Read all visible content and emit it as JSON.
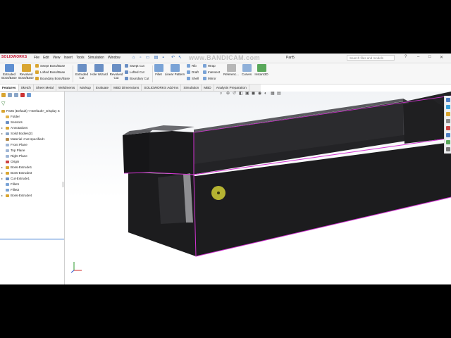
{
  "app": {
    "logo": "SOLIDWORKS",
    "document_title": "Part5",
    "watermark": "www.BANDICAM.com"
  },
  "menu": [
    "File",
    "Edit",
    "View",
    "Insert",
    "Tools",
    "Simulation",
    "Window"
  ],
  "search": {
    "placeholder": "Search files and models"
  },
  "window_controls": [
    "–",
    "□",
    "✕"
  ],
  "commands": {
    "extruded_boss": "Extruded Boss/Base",
    "revolved_boss": "Revolved Boss/Base",
    "swept_boss": "Swept Boss/Base",
    "lofted_boss": "Lofted Boss/Base",
    "boundary_boss": "Boundary Boss/Base",
    "extruded_cut": "Extruded Cut",
    "hole_wizard": "Hole Wizard",
    "revolved_cut": "Revolved Cut",
    "swept_cut": "Swept Cut",
    "lofted_cut": "Lofted Cut",
    "boundary_cut": "Boundary Cut",
    "fillet": "Fillet",
    "linear_pattern": "Linear Pattern",
    "rib": "Rib",
    "wrap": "Wrap",
    "draft": "Draft",
    "intersect": "Intersect",
    "shell": "Shell",
    "mirror": "Mirror",
    "reference_geometry": "Referenc...",
    "curves": "Curves",
    "instant3d": "Instant3D"
  },
  "tabs": [
    "Features",
    "Sketch",
    "Sheet Metal",
    "Weldments",
    "Markup",
    "Evaluate",
    "MBD Dimensions",
    "SOLIDWORKS Add-Ins",
    "Simulation",
    "MBD",
    "Analysis Preparation"
  ],
  "active_tab": "Features",
  "tree": {
    "root": "Part5 (Default) <<Default>_Display S",
    "items": [
      {
        "label": "Folder",
        "icon": "folder-icon",
        "expandable": false
      },
      {
        "label": "Sensors",
        "icon": "sensor-icon",
        "expandable": false
      },
      {
        "label": "Annotations",
        "icon": "annotation-icon",
        "expandable": true
      },
      {
        "label": "Solid Bodies(2)",
        "icon": "solid-bodies-icon",
        "expandable": true
      },
      {
        "label": "Material <not specified>",
        "icon": "material-icon",
        "expandable": false
      },
      {
        "label": "Front Plane",
        "icon": "plane-icon",
        "expandable": false
      },
      {
        "label": "Top Plane",
        "icon": "plane-icon",
        "expandable": false
      },
      {
        "label": "Right Plane",
        "icon": "plane-icon",
        "expandable": false
      },
      {
        "label": "Origin",
        "icon": "origin-icon",
        "expandable": false
      },
      {
        "label": "Boss-Extrude1",
        "icon": "extrude-icon",
        "expandable": true
      },
      {
        "label": "Boss-Extrude3",
        "icon": "extrude-icon",
        "expandable": true
      },
      {
        "label": "Cut-Extrude1",
        "icon": "cut-icon",
        "expandable": true
      },
      {
        "label": "Fillet1",
        "icon": "fillet-icon",
        "expandable": false
      },
      {
        "label": "Fillet2",
        "icon": "fillet-icon",
        "expandable": false
      },
      {
        "label": "Boss-Extrude4",
        "icon": "extrude-icon",
        "expandable": true
      }
    ]
  },
  "colors": {
    "body": "#1c1c1e",
    "edge_highlight": "#d233d2",
    "cursor": "#e8e63a",
    "accent": "#2563b5"
  }
}
